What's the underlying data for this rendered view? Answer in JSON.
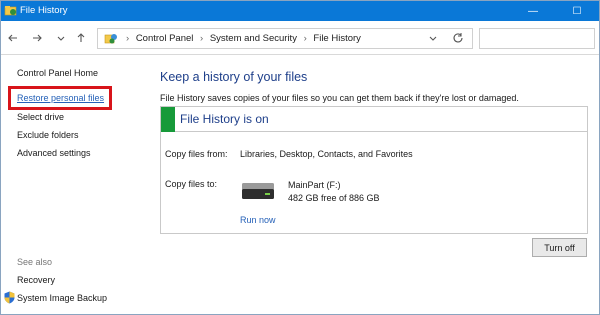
{
  "window": {
    "title": "File History",
    "minimize_glyph": "—",
    "maximize_glyph": "☐",
    "title_bar_color": "#0a78d7"
  },
  "navigation": {
    "back_icon": "back-arrow-icon",
    "forward_icon": "forward-arrow-icon",
    "recent_icon": "chevron-down-icon",
    "up_icon": "up-arrow-icon",
    "breadcrumbs": [
      "Control Panel",
      "System and Security",
      "File History"
    ],
    "separator": "›"
  },
  "sidebar": {
    "home_link": "Control Panel Home",
    "items": [
      {
        "label": "Restore personal files",
        "highlighted": true
      },
      {
        "label": "Select drive"
      },
      {
        "label": "Exclude folders"
      },
      {
        "label": "Advanced settings"
      }
    ],
    "see_also_label": "See also",
    "see_also_items": [
      {
        "label": "Recovery"
      },
      {
        "label": "System Image Backup"
      }
    ]
  },
  "main": {
    "heading": "Keep a history of your files",
    "description": "File History saves copies of your files so you can get them back if they're lost or damaged.",
    "status": "File History is on",
    "status_color": "#179a3a",
    "copy_from_label": "Copy files from:",
    "copy_from_value": "Libraries, Desktop, Contacts, and Favorites",
    "copy_to_label": "Copy files to:",
    "drive_name": "MainPart (F:)",
    "drive_space": "482 GB free of 886 GB",
    "run_now": "Run now",
    "turn_off": "Turn off"
  }
}
